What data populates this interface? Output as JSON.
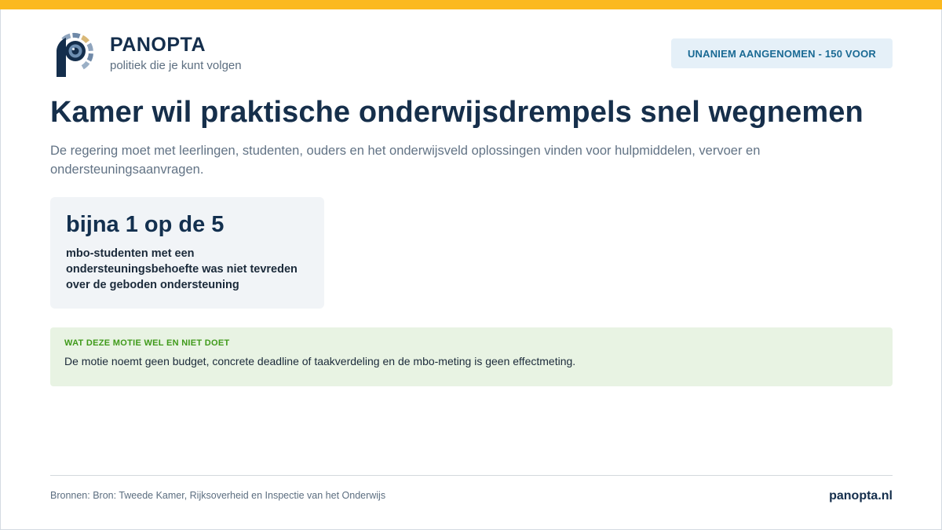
{
  "brand": {
    "name": "PANOPTA",
    "tagline": "politiek die je kunt volgen",
    "domain": "panopta.nl",
    "logo_icon": "eye-p-logo-icon"
  },
  "badge": {
    "label": "UNANIEM AANGENOMEN - 150 VOOR"
  },
  "article": {
    "headline": "Kamer wil praktische onderwijsdrempels snel wegnemen",
    "lede": "De regering moet met leerlingen, studenten, ouders en het onderwijsveld oplossingen vinden voor hulpmiddelen, vervoer en ondersteuningsaanvragen."
  },
  "stat": {
    "value": "bijna 1 op de 5",
    "description": "mbo-studenten met een ondersteuningsbehoefte was niet tevreden over de geboden ondersteuning"
  },
  "note": {
    "label": "WAT DEZE MOTIE WEL EN NIET DOET",
    "text": "De motie noemt geen budget, concrete deadline of taakverdeling en de mbo-meting is geen effectmeting."
  },
  "footer": {
    "sources": "Bronnen: Bron: Tweede Kamer, Rijksoverheid en Inspectie van het Onderwijs"
  },
  "colors": {
    "accent_bar": "#fbb91f",
    "brand_navy": "#142e4c",
    "badge_bg": "#e5f0f8",
    "badge_text": "#1a6a94",
    "note_bg": "#e8f3e3",
    "note_label": "#3f9a1a"
  }
}
